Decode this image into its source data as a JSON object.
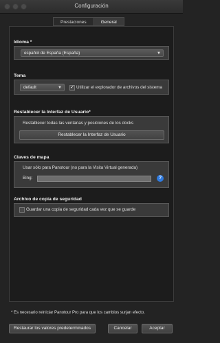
{
  "window": {
    "title": "Configuración"
  },
  "tabs": [
    {
      "label": "Prestaciones",
      "active": false
    },
    {
      "label": "General",
      "active": true
    }
  ],
  "idioma": {
    "title": "Idioma *",
    "selected": "español de España (España)"
  },
  "tema": {
    "title": "Tema",
    "selected": "default",
    "checkbox_label": "Utilizar el explorador de archivos del sistema",
    "checkbox_checked": true,
    "check_glyph": "✓"
  },
  "reset": {
    "title": "Restablecer la Interfaz de Usuario*",
    "description": "Restablecer todas las ventanas y posiciones de los docks",
    "button": "Restablecer la Interfaz de Usuario"
  },
  "maps": {
    "title": "Claves de mapa",
    "description": "Usar sólo para Panotour (no para la Visita Virtual generada)",
    "bing_label": "Bing:",
    "bing_value": "",
    "help_glyph": "?"
  },
  "backup": {
    "title": "Archivo de copia de seguridad",
    "checkbox_label": "Guardar una copia de seguridad cada vez que se guarde",
    "checkbox_checked": false
  },
  "footer": {
    "note": "* Es necesario reiniciar Panotour Pro para que los cambios surjan efecto.",
    "restore_button": "Restaurar los valores predeterminados",
    "cancel_button": "Cancelar",
    "accept_button": "Aceptar"
  },
  "icons": {
    "dropdown": "chevron-updown-icon",
    "help": "help-icon",
    "check": "checkmark-icon"
  }
}
